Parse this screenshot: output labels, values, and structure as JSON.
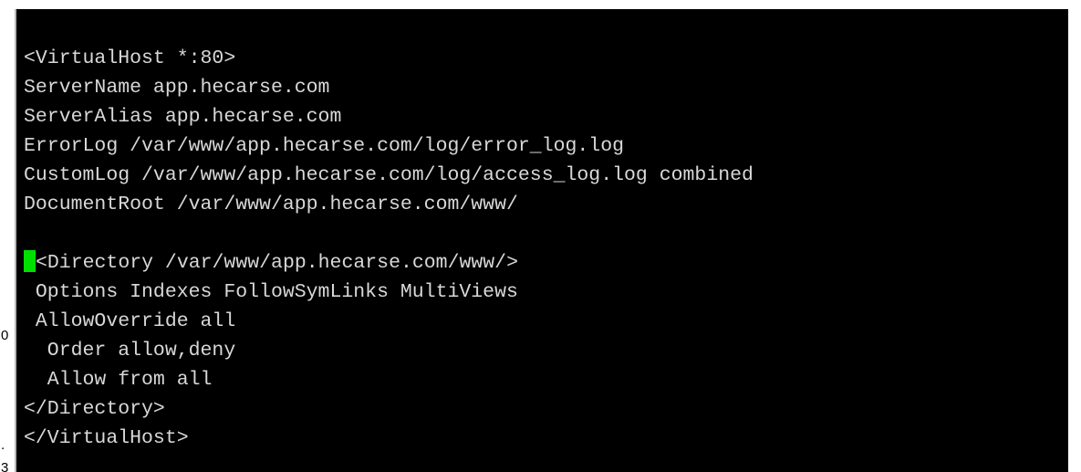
{
  "colors": {
    "terminal_background": "#000000",
    "terminal_text": "#d8d8d8",
    "cursor": "#00e000",
    "page_background": "#ffffff"
  },
  "left_edge_fragments": {
    "fragment_a": "0",
    "fragment_b": ".",
    "fragment_c": "3"
  },
  "terminal": {
    "lines": [
      "<VirtualHost *:80>",
      "ServerName app.hecarse.com",
      "ServerAlias app.hecarse.com",
      "ErrorLog /var/www/app.hecarse.com/log/error_log.log",
      "CustomLog /var/www/app.hecarse.com/log/access_log.log combined",
      "DocumentRoot /var/www/app.hecarse.com/www/",
      "",
      "<Directory /var/www/app.hecarse.com/www/>",
      " Options Indexes FollowSymLinks MultiViews",
      " AllowOverride all",
      "  Order allow,deny",
      "  Allow from all",
      "</Directory>",
      "</VirtualHost>"
    ]
  }
}
